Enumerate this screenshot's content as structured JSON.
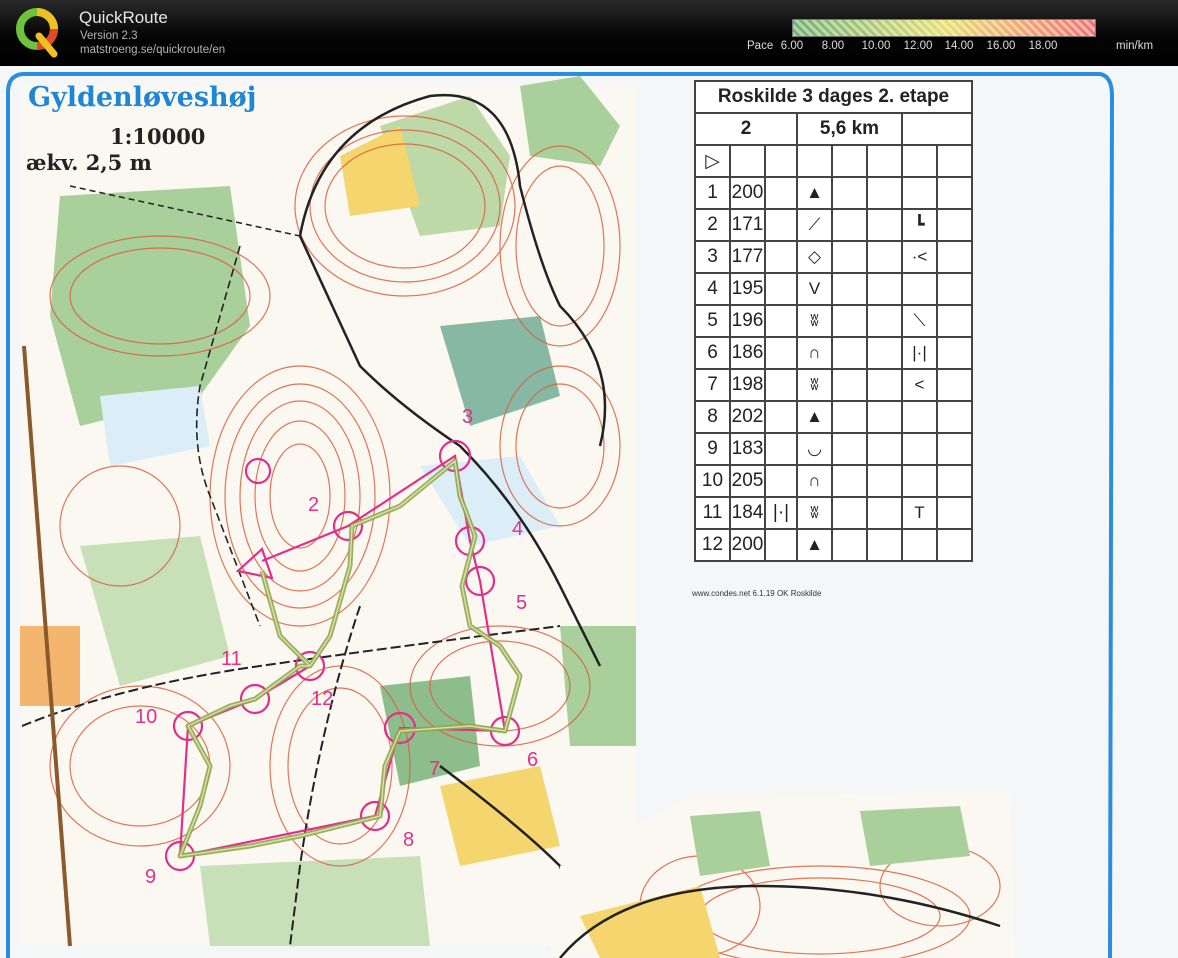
{
  "app": {
    "name": "QuickRoute",
    "version": "Version 2.3",
    "url": "matstroeng.se/quickroute/en"
  },
  "pace_legend": {
    "label": "Pace",
    "ticks": [
      "6.00",
      "8.00",
      "10.00",
      "12.00",
      "14.00",
      "16.00",
      "18.00"
    ],
    "unit": "min/km",
    "colors": [
      "#70b070",
      "#a8c870",
      "#e6e070",
      "#f0b070",
      "#f07070"
    ]
  },
  "map": {
    "title": "Gyldenløveshøj",
    "scale": "1:10000",
    "equidistance": "ækv. 2,5 m",
    "control_numbers": [
      "2",
      "3",
      "4",
      "5",
      "6",
      "7",
      "8",
      "9",
      "10",
      "11",
      "12"
    ]
  },
  "control_description": {
    "event": "Roskilde 3 dages 2. etape",
    "course": "2",
    "length": "5,6 km",
    "start_symbol": "▷",
    "rows": [
      {
        "n": "1",
        "code": "200",
        "c": "",
        "feature": "▲",
        "where": ""
      },
      {
        "n": "2",
        "code": "171",
        "c": "",
        "feature": "⟋",
        "where": "┗"
      },
      {
        "n": "3",
        "code": "177",
        "c": "",
        "feature": "◇",
        "where": "·<"
      },
      {
        "n": "4",
        "code": "195",
        "c": "",
        "feature": "V",
        "where": ""
      },
      {
        "n": "5",
        "code": "196",
        "c": "",
        "feature": "ʬ",
        "where": "⟍"
      },
      {
        "n": "6",
        "code": "186",
        "c": "",
        "feature": "∩",
        "where": "|·|"
      },
      {
        "n": "7",
        "code": "198",
        "c": "",
        "feature": "ʬ",
        "where": "<"
      },
      {
        "n": "8",
        "code": "202",
        "c": "",
        "feature": "▲",
        "where": ""
      },
      {
        "n": "9",
        "code": "183",
        "c": "",
        "feature": "◡",
        "where": ""
      },
      {
        "n": "10",
        "code": "205",
        "c": "",
        "feature": "∩",
        "where": ""
      },
      {
        "n": "11",
        "code": "184",
        "c": "|·|",
        "feature": "ʬ",
        "where": "T"
      },
      {
        "n": "12",
        "code": "200",
        "c": "",
        "feature": "▲",
        "where": ""
      }
    ],
    "footer": "www.condes.net 6.1.19 OK Roskilde"
  }
}
